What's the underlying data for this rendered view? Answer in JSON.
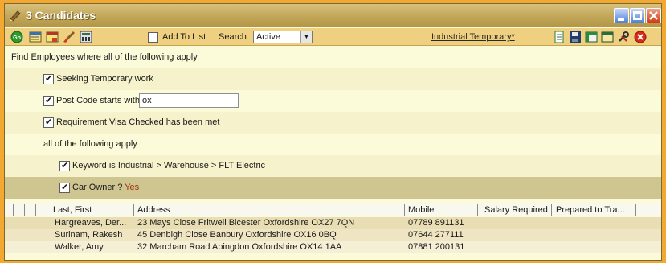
{
  "window": {
    "title": "3 Candidates"
  },
  "toolbar": {
    "add_to_list_label": "Add To List",
    "search_label": "Search",
    "search_value": "Active",
    "link_label": "Industrial Temporary*"
  },
  "criteria": {
    "heading": "Find Employees where all of the following apply",
    "seeking": "Seeking Temporary work",
    "postcode_label": "Post Code starts with",
    "postcode_value": "ox",
    "visa": "Requirement Visa Checked has been met",
    "subgroup": "all of the following apply",
    "keyword": "Keyword is Industrial > Warehouse > FLT Electric",
    "car_owner_label": "Car Owner ?",
    "car_owner_value": "Yes"
  },
  "grid": {
    "columns": [
      "Last, First",
      "Address",
      "Mobile",
      "Salary Required",
      "Prepared to Tra..."
    ],
    "rows": [
      {
        "name": "Hargreaves, Der...",
        "address": "23 Mays Close Fritwell Bicester Oxfordshire OX27 7QN",
        "mobile": "07789 891131"
      },
      {
        "name": "Surinam, Rakesh",
        "address": "45 Denbigh Close Banbury Oxfordshire OX16 0BQ",
        "mobile": "07644 277111"
      },
      {
        "name": "Walker, Amy",
        "address": "32 Marcham Road Abingdon Oxfordshire OX14 1AA",
        "mobile": "07881 200131"
      }
    ]
  },
  "colors": {
    "background": "#f3a931",
    "titlebar": "#c2a75a",
    "toolbar": "#efd080",
    "panel": "#fbfbd9"
  }
}
